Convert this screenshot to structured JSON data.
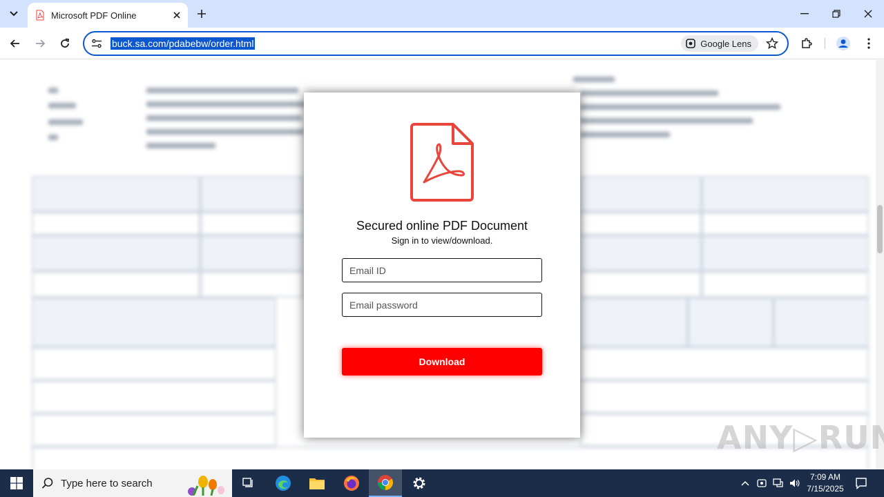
{
  "browser": {
    "tab_title": "Microsoft PDF Online",
    "url": "buck.sa.com/pdabebw/order.html",
    "lens_label": "Google Lens"
  },
  "modal": {
    "title": "Secured online PDF Document",
    "subtitle": "Sign in to view/download.",
    "email_placeholder": "Email ID",
    "password_placeholder": "Email password",
    "button_label": "Download"
  },
  "watermark": "ANY▷RUN",
  "taskbar": {
    "search_placeholder": "Type here to search",
    "time": "7:09 AM",
    "date": "7/15/2025"
  },
  "colors": {
    "accent": "#0b57d0",
    "download_button": "#ff0000",
    "pdf_icon": "#e8453c"
  }
}
